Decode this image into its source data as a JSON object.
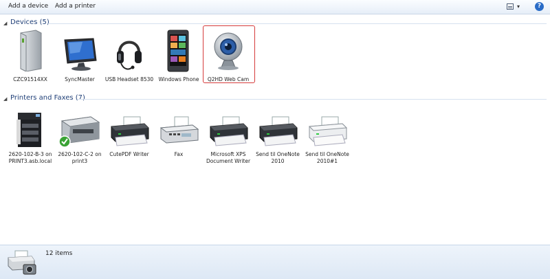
{
  "toolbar": {
    "add_device": "Add a device",
    "add_printer": "Add a printer",
    "view_icon": "view-options-icon",
    "view_arrow": "▾",
    "help_icon": "help-icon",
    "help_glyph": "?"
  },
  "groups": {
    "devices": {
      "title": "Devices (5)",
      "items": [
        {
          "label": "CZC91514XX",
          "icon": "computer-tower-icon"
        },
        {
          "label": "SyncMaster",
          "icon": "monitor-icon"
        },
        {
          "label": "USB Headset 8530",
          "icon": "headset-icon"
        },
        {
          "label": "Windows Phone",
          "icon": "phone-icon"
        },
        {
          "label": "Q2HD Web Cam",
          "icon": "webcam-icon"
        }
      ]
    },
    "printers": {
      "title": "Printers and Faxes (7)",
      "items": [
        {
          "label": "2620-102-B-3 on PRINT3.asb.local",
          "icon": "copier-icon"
        },
        {
          "label": "2620-102-C-2 on print3",
          "icon": "printer-default-icon"
        },
        {
          "label": "CutePDF Writer",
          "icon": "printer-icon"
        },
        {
          "label": "Fax",
          "icon": "fax-icon"
        },
        {
          "label": "Microsoft XPS Document Writer",
          "icon": "printer-icon"
        },
        {
          "label": "Send til OneNote 2010",
          "icon": "printer-icon"
        },
        {
          "label": "Send til OneNote 2010#1",
          "icon": "printer-icon"
        }
      ]
    }
  },
  "status": {
    "count": "12 items",
    "icon": "devices-printers-icon"
  },
  "colors": {
    "selection_border": "#d53a3a",
    "group_title": "#1f3f77",
    "default_check": "#3aa335"
  }
}
